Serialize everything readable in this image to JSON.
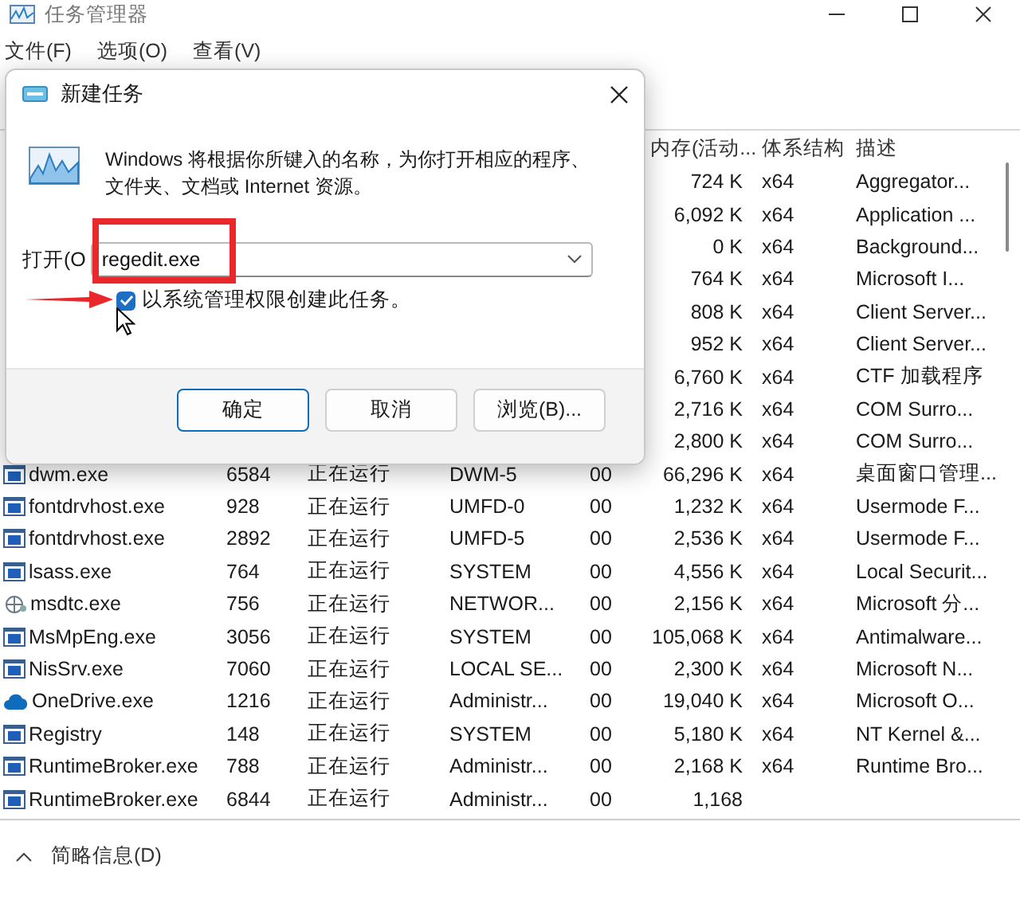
{
  "window": {
    "title": "任务管理器"
  },
  "menu": [
    "文件(F)",
    "选项(O)",
    "查看(V)"
  ],
  "columns": [
    "内存(活动...",
    "体系结构",
    "描述"
  ],
  "processes": [
    {
      "memory": "724 K",
      "arch": "x64",
      "description": "Aggregator..."
    },
    {
      "memory": "6,092 K",
      "arch": "x64",
      "description": "Application ..."
    },
    {
      "memory": "0 K",
      "arch": "x64",
      "description": "Background..."
    },
    {
      "memory": "764 K",
      "arch": "x64",
      "description": "Microsoft I..."
    },
    {
      "memory": "808 K",
      "arch": "x64",
      "description": "Client Server..."
    },
    {
      "memory": "952 K",
      "arch": "x64",
      "description": "Client Server..."
    },
    {
      "memory": "6,760 K",
      "arch": "x64",
      "description": "CTF 加载程序"
    },
    {
      "memory": "2,716 K",
      "arch": "x64",
      "description": "COM Surro..."
    },
    {
      "memory": "2,800 K",
      "arch": "x64",
      "description": "COM Surro..."
    },
    {
      "kind": "app",
      "name": "dwm.exe",
      "pid": "6584",
      "status": "正在运行",
      "user": "DWM-5",
      "cpu": "00",
      "memory": "66,296 K",
      "arch": "x64",
      "description": "桌面窗口管理..."
    },
    {
      "kind": "app",
      "name": "fontdrvhost.exe",
      "pid": "928",
      "status": "正在运行",
      "user": "UMFD-0",
      "cpu": "00",
      "memory": "1,232 K",
      "arch": "x64",
      "description": "Usermode F..."
    },
    {
      "kind": "app",
      "name": "fontdrvhost.exe",
      "pid": "2892",
      "status": "正在运行",
      "user": "UMFD-5",
      "cpu": "00",
      "memory": "2,536 K",
      "arch": "x64",
      "description": "Usermode F..."
    },
    {
      "kind": "app",
      "name": "lsass.exe",
      "pid": "764",
      "status": "正在运行",
      "user": "SYSTEM",
      "cpu": "00",
      "memory": "4,556 K",
      "arch": "x64",
      "description": "Local Securit..."
    },
    {
      "kind": "network",
      "name": "msdtc.exe",
      "pid": "756",
      "status": "正在运行",
      "user": "NETWOR...",
      "cpu": "00",
      "memory": "2,156 K",
      "arch": "x64",
      "description": "Microsoft 分..."
    },
    {
      "kind": "app",
      "name": "MsMpEng.exe",
      "pid": "3056",
      "status": "正在运行",
      "user": "SYSTEM",
      "cpu": "00",
      "memory": "105,068 K",
      "arch": "x64",
      "description": "Antimalware..."
    },
    {
      "kind": "app",
      "name": "NisSrv.exe",
      "pid": "7060",
      "status": "正在运行",
      "user": "LOCAL SE...",
      "cpu": "00",
      "memory": "2,300 K",
      "arch": "x64",
      "description": "Microsoft N..."
    },
    {
      "kind": "cloud",
      "name": "OneDrive.exe",
      "pid": "1216",
      "status": "正在运行",
      "user": "Administr...",
      "cpu": "00",
      "memory": "19,040 K",
      "arch": "x64",
      "description": "Microsoft O..."
    },
    {
      "kind": "app",
      "name": "Registry",
      "pid": "148",
      "status": "正在运行",
      "user": "SYSTEM",
      "cpu": "00",
      "memory": "5,180 K",
      "arch": "x64",
      "description": "NT Kernel &..."
    },
    {
      "kind": "app",
      "name": "RuntimeBroker.exe",
      "pid": "788",
      "status": "正在运行",
      "user": "Administr...",
      "cpu": "00",
      "memory": "2,168 K",
      "arch": "x64",
      "description": "Runtime Bro..."
    },
    {
      "kind": "app",
      "name": "RuntimeBroker.exe",
      "pid": "6844",
      "status": "正在运行",
      "user": "Administr...",
      "cpu": "00",
      "memory": "1,168"
    }
  ],
  "status_bar": {
    "toggle": "简略信息(D)"
  },
  "dialog": {
    "title": "新建任务",
    "message": "Windows 将根据你所键入的名称，为你打开相应的程序、文件夹、文档或 Internet 资源。",
    "open_label": "打开(O",
    "command": "regedit.exe",
    "run_as_admin": {
      "label": "以系统管理权限创建此任务。",
      "checked": true
    },
    "buttons": [
      {
        "label": "确定",
        "default": true
      },
      {
        "label": "取消",
        "default": false
      },
      {
        "label": "浏览(B)...",
        "default": false
      }
    ]
  }
}
